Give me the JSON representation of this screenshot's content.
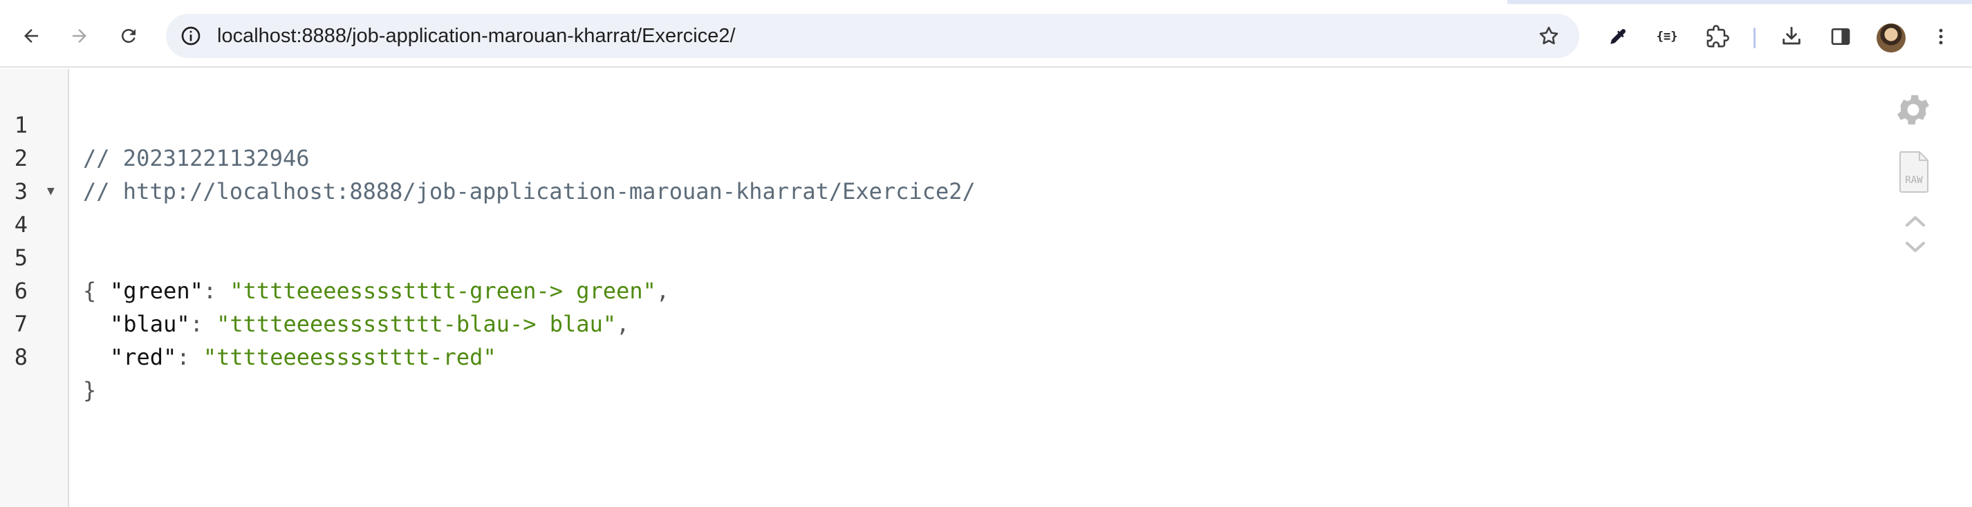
{
  "browser": {
    "url": "localhost:8888/job-application-marouan-kharrat/Exercice2/",
    "ext_json_label": "{≡}"
  },
  "viewer": {
    "line_numbers": [
      "1",
      "2",
      "3",
      "4",
      "5",
      "6",
      "7",
      "8"
    ],
    "comment_timestamp": "// 20231221132946",
    "comment_url": "// http://localhost:8888/job-application-marouan-kharrat/Exercice2/",
    "open_brace": "{",
    "close_brace": "}",
    "entries": [
      {
        "key": "\"green\"",
        "colon": ": ",
        "value": "\"tttteeeesssstttt-green-> green\"",
        "comma": ","
      },
      {
        "key": "\"blau\"",
        "colon": ": ",
        "value": "\"tttteeeesssstttt-blau-> blau\"",
        "comma": ","
      },
      {
        "key": "\"red\"",
        "colon": ": ",
        "value": "\"tttteeeesssstttt-red\"",
        "comma": ""
      }
    ],
    "raw_label": "RAW"
  },
  "colors": {
    "string": "#4f8a10",
    "comment": "#5c6b79",
    "omnibox": "#eef1f8"
  }
}
